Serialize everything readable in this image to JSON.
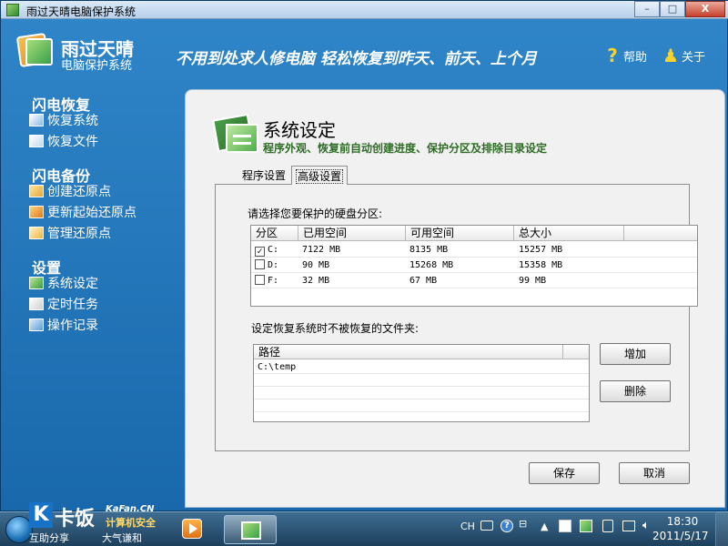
{
  "window": {
    "title": "雨过天晴电脑保护系统",
    "minimize": "–",
    "maximize": "□",
    "close": "X"
  },
  "header": {
    "app_name": "雨过天晴",
    "app_subtitle": "电脑保护系统",
    "slogan": "不用到处求人修电脑 轻松恢复到昨天、前天、上个月",
    "help_label": "帮助",
    "about_label": "关于"
  },
  "sidebar": {
    "sections": [
      {
        "title": "闪电恢复",
        "items": [
          {
            "label": "恢复系统",
            "icon": "restore-system-icon"
          },
          {
            "label": "恢复文件",
            "icon": "restore-file-icon"
          }
        ]
      },
      {
        "title": "闪电备份",
        "items": [
          {
            "label": "创建还原点",
            "icon": "create-restore-point-icon"
          },
          {
            "label": "更新起始还原点",
            "icon": "update-restore-point-icon"
          },
          {
            "label": "管理还原点",
            "icon": "manage-restore-point-icon"
          }
        ]
      },
      {
        "title": "设置",
        "items": [
          {
            "label": "系统设定",
            "icon": "system-settings-icon"
          },
          {
            "label": "定时任务",
            "icon": "scheduled-task-icon"
          },
          {
            "label": "操作记录",
            "icon": "operation-log-icon"
          }
        ]
      }
    ]
  },
  "panel": {
    "title": "系统设定",
    "description": "程序外观、恢复前自动创建进度、保护分区及排除目录设定",
    "tabs": [
      {
        "label": "程序设置",
        "active": false
      },
      {
        "label": "高级设置",
        "active": true
      }
    ],
    "partition_prompt": "请选择您要保护的硬盘分区:",
    "partition_columns": [
      "分区",
      "已用空间",
      "可用空间",
      "总大小"
    ],
    "partitions": [
      {
        "checked": true,
        "drive": "C:",
        "used": "7122 MB",
        "free": "8135 MB",
        "total": "15257 MB"
      },
      {
        "checked": false,
        "drive": "D:",
        "used": "90 MB",
        "free": "15268 MB",
        "total": "15358 MB"
      },
      {
        "checked": false,
        "drive": "F:",
        "used": "32 MB",
        "free": "67 MB",
        "total": "99 MB"
      }
    ],
    "exclude_prompt": "设定恢复系统时不被恢复的文件夹:",
    "path_column": "路径",
    "paths": [
      "C:\\temp"
    ],
    "add_button": "增加",
    "delete_button": "删除",
    "save_button": "保存",
    "cancel_button": "取消"
  },
  "taskbar": {
    "brand": "卡饭",
    "brand_site": "KaFan.CN",
    "brand_slogan": "计算机安全",
    "brand_left": "互助分享",
    "brand_right": "大气谦和",
    "lang": "CH",
    "time": "18:30",
    "date": "2011/5/17"
  }
}
